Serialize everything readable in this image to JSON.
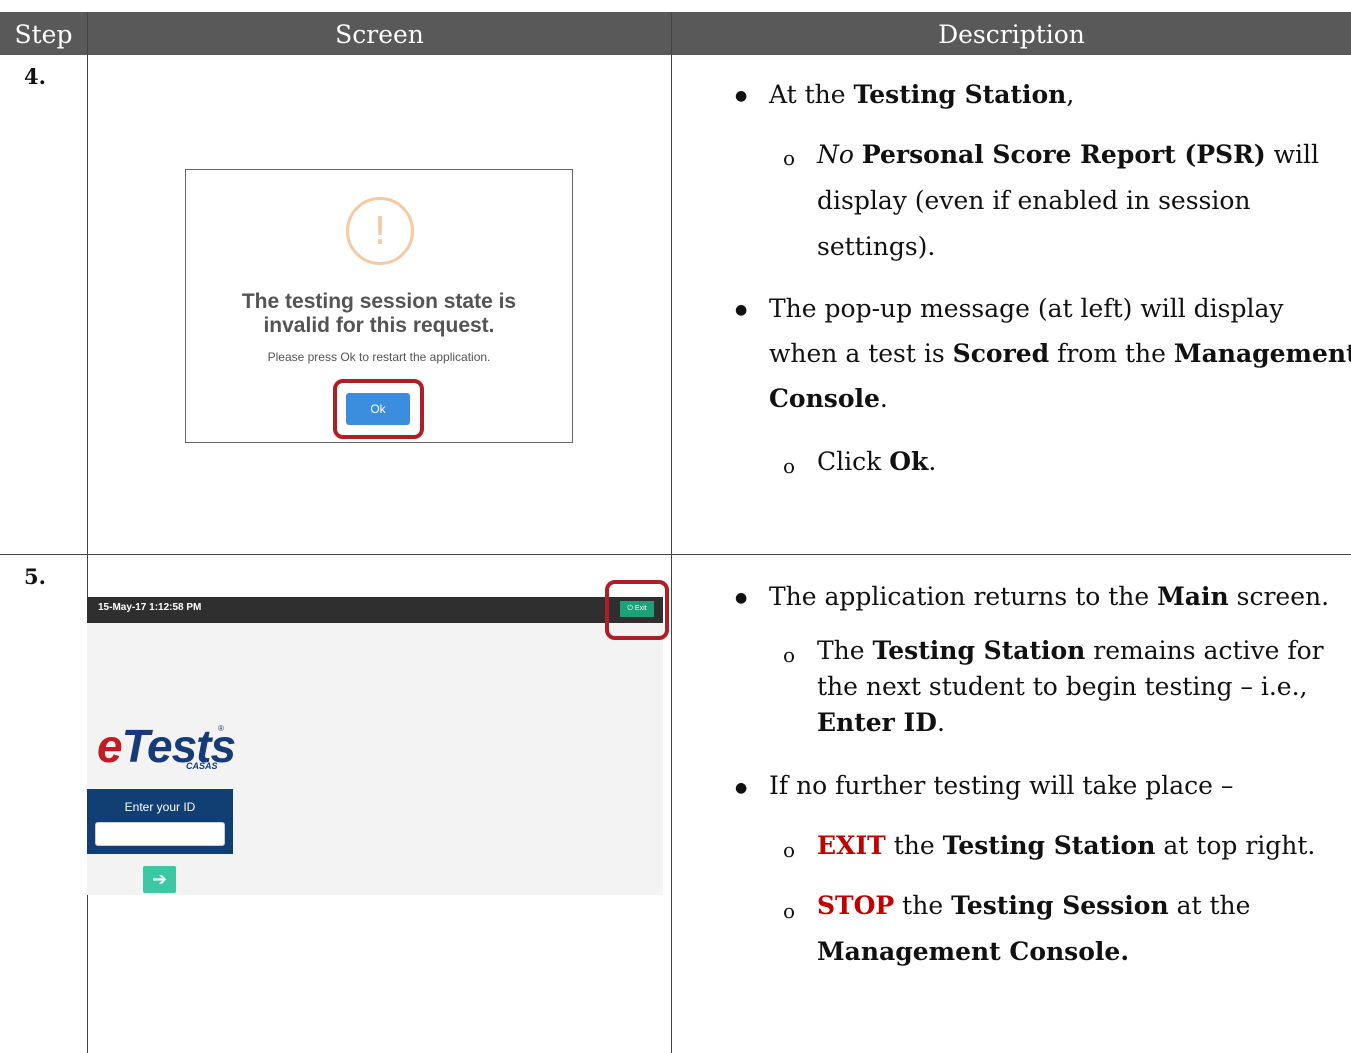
{
  "headers": {
    "step": "Step",
    "screen": "Screen",
    "description": "Description"
  },
  "row4": {
    "step": "4.",
    "dialog": {
      "icon": "warning-icon",
      "mark": "!",
      "title_line1": "The testing session state is",
      "title_line2": "invalid for this request.",
      "message": "Please press Ok to restart the application.",
      "ok_label": "Ok"
    },
    "desc": {
      "b1_pre": "At the ",
      "b1_bold": "Testing Station",
      "b1_post": ",",
      "s1_italic": "No",
      "s1_bold": "Personal Score Report (PSR)",
      "s1_post": " will",
      "s1_line2": "display (even if enabled in session",
      "s1_line3": "settings).",
      "b2_line1": "The pop-up message (at left) will display",
      "b2_line2_pre": "when a test is ",
      "b2_line2_bold1": "Scored",
      "b2_line2_mid": " from the ",
      "b2_line2_bold2": "Management",
      "b2_line3_bold": "Console",
      "b2_line3_post": ".",
      "s2_pre": "Click ",
      "s2_bold": "Ok",
      "s2_post": "."
    }
  },
  "row5": {
    "step": "5.",
    "screen": {
      "datetime": "15-May-17 1:12:58 PM",
      "exit_label": "⏻ Exit",
      "logo_e": "e",
      "logo_rest": "Tests",
      "logo_reg": "®",
      "logo_casas": "CASAS",
      "id_label": "Enter your ID",
      "arrow": "➔"
    },
    "desc": {
      "b1_pre": "The application returns to the ",
      "b1_bold": "Main",
      "b1_post": " screen.",
      "s1_pre": "The ",
      "s1_bold": "Testing Station",
      "s1_post": " remains active for",
      "s1_line2": "the next student to begin testing – i.e.,",
      "s1_line3_bold": "Enter ID",
      "s1_line3_post": ".",
      "b2": "If no further testing will take place –",
      "s2_red": "EXIT",
      "s2_mid": " the ",
      "s2_bold": "Testing Station",
      "s2_post": " at top right.",
      "s3_red": "STOP",
      "s3_mid": " the ",
      "s3_bold": "Testing Session",
      "s3_post": " at the",
      "s3_line2_bold": "Management Console."
    }
  },
  "colors": {
    "header_bg": "#595959",
    "highlight": "#b01e23",
    "red_text": "#c00000",
    "ok_button": "#3b8ede",
    "exit_button": "#1aa37a"
  }
}
